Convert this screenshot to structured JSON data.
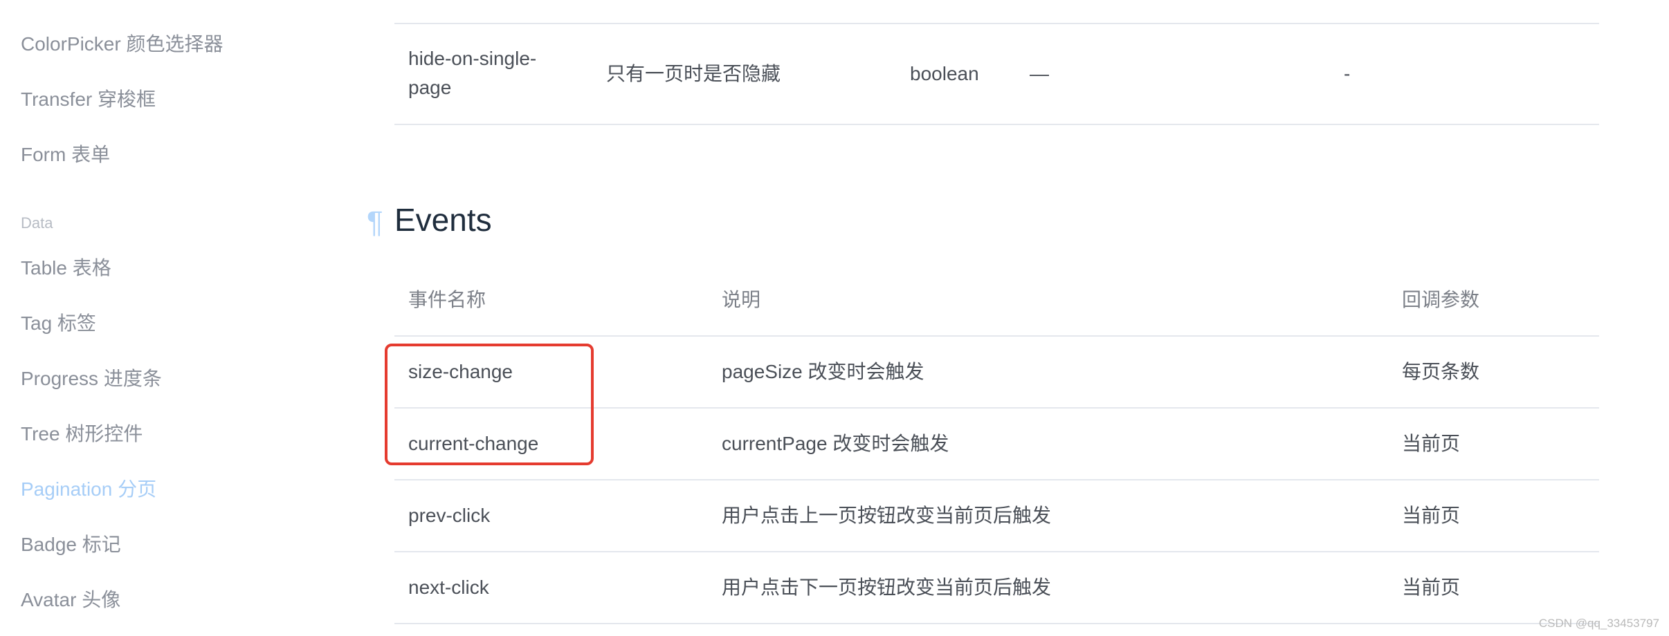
{
  "sidebar": {
    "items": [
      {
        "label": "ColorPicker 颜色选择器"
      },
      {
        "label": "Transfer 穿梭框"
      },
      {
        "label": "Form 表单"
      },
      {
        "label": "Table 表格"
      },
      {
        "label": "Tag 标签"
      },
      {
        "label": "Progress 进度条"
      },
      {
        "label": "Tree 树形控件"
      },
      {
        "label": "Pagination 分页"
      },
      {
        "label": "Badge 标记"
      },
      {
        "label": "Avatar 头像"
      }
    ],
    "group_label": "Data",
    "active_item": "Pagination 分页"
  },
  "attributes_table": {
    "row": {
      "name": "hide-on-single-page",
      "description": "只有一页时是否隐藏",
      "type": "boolean",
      "options": "—",
      "default": "-"
    }
  },
  "events": {
    "anchor": "¶",
    "title": "Events",
    "headers": [
      "事件名称",
      "说明",
      "回调参数"
    ],
    "rows": [
      {
        "name": "size-change",
        "description": "pageSize 改变时会触发",
        "params": "每页条数"
      },
      {
        "name": "current-change",
        "description": "currentPage 改变时会触发",
        "params": "当前页"
      },
      {
        "name": "prev-click",
        "description": "用户点击上一页按钮改变当前页后触发",
        "params": "当前页"
      },
      {
        "name": "next-click",
        "description": "用户点击下一页按钮改变当前页后触发",
        "params": "当前页"
      }
    ]
  },
  "watermark": "CSDN @qq_33453797",
  "colors": {
    "active_sidebar": "#a6cdf7",
    "highlight_box": "#e53b2f",
    "anchor": "#b3d6fb"
  }
}
